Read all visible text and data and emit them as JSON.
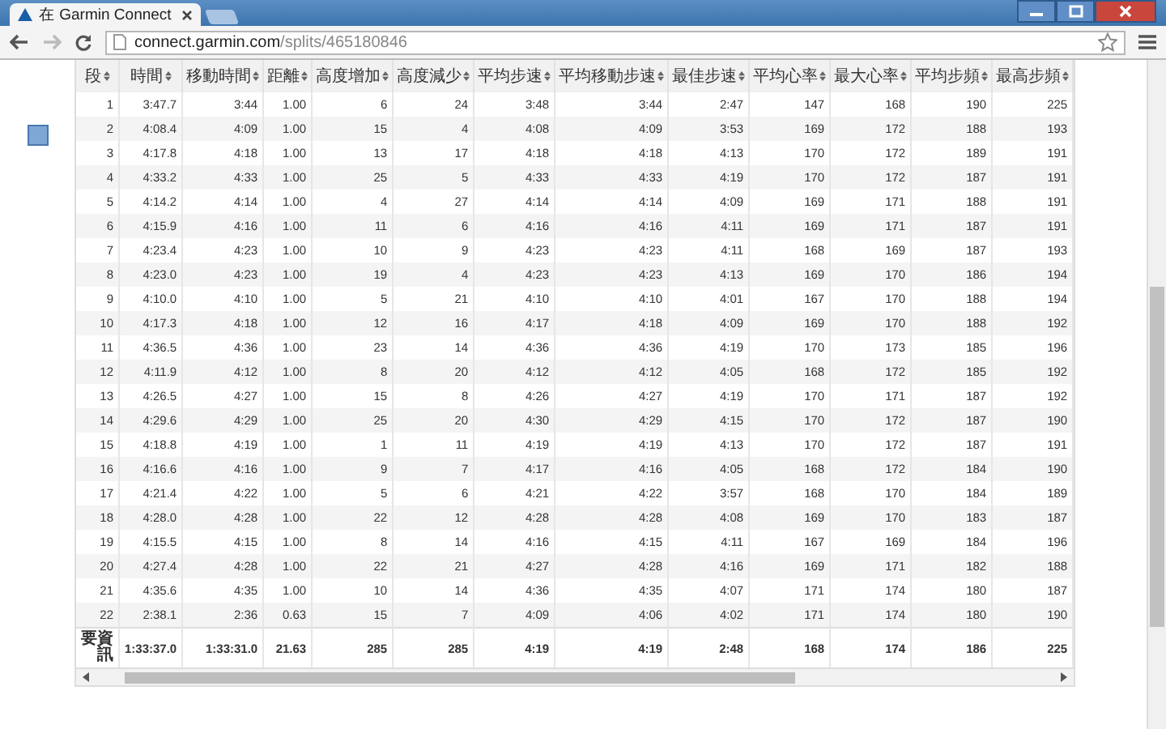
{
  "browser": {
    "tab_title": "在 Garmin Connect",
    "url_host": "connect.garmin.com",
    "url_path": "/splits/465180846"
  },
  "table": {
    "columns": [
      "段",
      "時間",
      "移動時間",
      "距離",
      "高度增加",
      "高度減少",
      "平均步速",
      "平均移動步速",
      "最佳步速",
      "平均心率",
      "最大心率",
      "平均步頻",
      "最高步頻"
    ],
    "rows": [
      [
        "1",
        "3:47.7",
        "3:44",
        "1.00",
        "6",
        "24",
        "3:48",
        "3:44",
        "2:47",
        "147",
        "168",
        "190",
        "225"
      ],
      [
        "2",
        "4:08.4",
        "4:09",
        "1.00",
        "15",
        "4",
        "4:08",
        "4:09",
        "3:53",
        "169",
        "172",
        "188",
        "193"
      ],
      [
        "3",
        "4:17.8",
        "4:18",
        "1.00",
        "13",
        "17",
        "4:18",
        "4:18",
        "4:13",
        "170",
        "172",
        "189",
        "191"
      ],
      [
        "4",
        "4:33.2",
        "4:33",
        "1.00",
        "25",
        "5",
        "4:33",
        "4:33",
        "4:19",
        "170",
        "172",
        "187",
        "191"
      ],
      [
        "5",
        "4:14.2",
        "4:14",
        "1.00",
        "4",
        "27",
        "4:14",
        "4:14",
        "4:09",
        "169",
        "171",
        "188",
        "191"
      ],
      [
        "6",
        "4:15.9",
        "4:16",
        "1.00",
        "11",
        "6",
        "4:16",
        "4:16",
        "4:11",
        "169",
        "171",
        "187",
        "191"
      ],
      [
        "7",
        "4:23.4",
        "4:23",
        "1.00",
        "10",
        "9",
        "4:23",
        "4:23",
        "4:11",
        "168",
        "169",
        "187",
        "193"
      ],
      [
        "8",
        "4:23.0",
        "4:23",
        "1.00",
        "19",
        "4",
        "4:23",
        "4:23",
        "4:13",
        "169",
        "170",
        "186",
        "194"
      ],
      [
        "9",
        "4:10.0",
        "4:10",
        "1.00",
        "5",
        "21",
        "4:10",
        "4:10",
        "4:01",
        "167",
        "170",
        "188",
        "194"
      ],
      [
        "10",
        "4:17.3",
        "4:18",
        "1.00",
        "12",
        "16",
        "4:17",
        "4:18",
        "4:09",
        "169",
        "170",
        "188",
        "192"
      ],
      [
        "11",
        "4:36.5",
        "4:36",
        "1.00",
        "23",
        "14",
        "4:36",
        "4:36",
        "4:19",
        "170",
        "173",
        "185",
        "196"
      ],
      [
        "12",
        "4:11.9",
        "4:12",
        "1.00",
        "8",
        "20",
        "4:12",
        "4:12",
        "4:05",
        "168",
        "172",
        "185",
        "192"
      ],
      [
        "13",
        "4:26.5",
        "4:27",
        "1.00",
        "15",
        "8",
        "4:26",
        "4:27",
        "4:19",
        "170",
        "171",
        "187",
        "192"
      ],
      [
        "14",
        "4:29.6",
        "4:29",
        "1.00",
        "25",
        "20",
        "4:30",
        "4:29",
        "4:15",
        "170",
        "172",
        "187",
        "190"
      ],
      [
        "15",
        "4:18.8",
        "4:19",
        "1.00",
        "1",
        "11",
        "4:19",
        "4:19",
        "4:13",
        "170",
        "172",
        "187",
        "191"
      ],
      [
        "16",
        "4:16.6",
        "4:16",
        "1.00",
        "9",
        "7",
        "4:17",
        "4:16",
        "4:05",
        "168",
        "172",
        "184",
        "190"
      ],
      [
        "17",
        "4:21.4",
        "4:22",
        "1.00",
        "5",
        "6",
        "4:21",
        "4:22",
        "3:57",
        "168",
        "170",
        "184",
        "189"
      ],
      [
        "18",
        "4:28.0",
        "4:28",
        "1.00",
        "22",
        "12",
        "4:28",
        "4:28",
        "4:08",
        "169",
        "170",
        "183",
        "187"
      ],
      [
        "19",
        "4:15.5",
        "4:15",
        "1.00",
        "8",
        "14",
        "4:16",
        "4:15",
        "4:11",
        "167",
        "169",
        "184",
        "196"
      ],
      [
        "20",
        "4:27.4",
        "4:28",
        "1.00",
        "22",
        "21",
        "4:27",
        "4:28",
        "4:16",
        "169",
        "171",
        "182",
        "188"
      ],
      [
        "21",
        "4:35.6",
        "4:35",
        "1.00",
        "10",
        "14",
        "4:36",
        "4:35",
        "4:07",
        "171",
        "174",
        "180",
        "187"
      ],
      [
        "22",
        "2:38.1",
        "2:36",
        "0.63",
        "15",
        "7",
        "4:09",
        "4:06",
        "4:02",
        "171",
        "174",
        "180",
        "190"
      ]
    ],
    "summary": [
      "要資訊",
      "1:33:37.0",
      "1:33:31.0",
      "21.63",
      "285",
      "285",
      "4:19",
      "4:19",
      "2:48",
      "168",
      "174",
      "186",
      "225"
    ]
  }
}
